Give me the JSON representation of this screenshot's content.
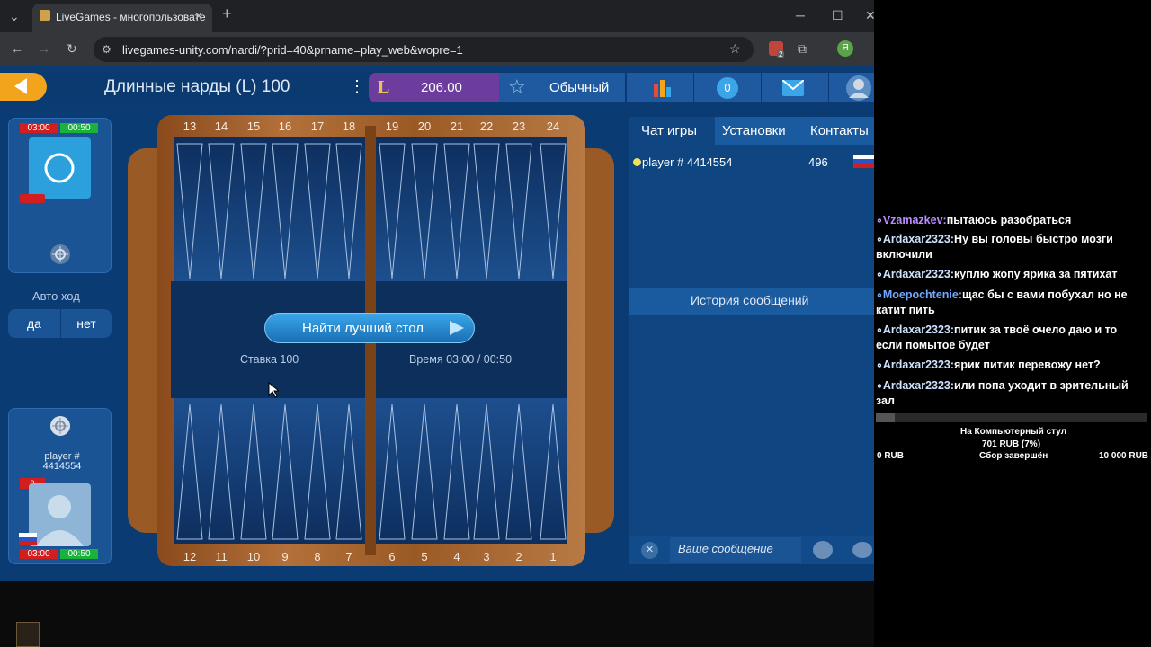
{
  "browser": {
    "tab_title": "LiveGames - многопользовате",
    "url": "livegames-unity.com/nardi/?prid=40&prname=play_web&wopre=1",
    "new_tab": "+",
    "min": "─",
    "max": "☐",
    "close": "✕",
    "profile_initial": "Я",
    "ext_badge": "2"
  },
  "game": {
    "title": "Длинные нарды (L) 100",
    "balance": "206.00",
    "mode": "Обычный",
    "badge_count": "0",
    "auto_move_label": "Авто ход",
    "auto_yes": "да",
    "auto_no": "нет",
    "find_table": "Найти лучший стол",
    "stake": "Ставка 100",
    "time": "Время 03:00 / 00:50",
    "top_numbers": [
      "13",
      "14",
      "15",
      "16",
      "17",
      "18",
      "19",
      "20",
      "21",
      "22",
      "23",
      "24"
    ],
    "bottom_numbers": [
      "12",
      "11",
      "10",
      "9",
      "8",
      "7",
      "6",
      "5",
      "4",
      "3",
      "2",
      "1"
    ]
  },
  "opponent": {
    "timer_main": "03:00",
    "timer_move": "00:50"
  },
  "player": {
    "name_line1": "player #",
    "name_line2": "4414554",
    "score": "0",
    "timer_main": "03:00",
    "timer_move": "00:50"
  },
  "chat": {
    "tabs": [
      "Чат игры",
      "Установки",
      "Контакты"
    ],
    "user_name": "player # 4414554",
    "user_rating": "496",
    "history": "История сообщений",
    "input_placeholder": "Ваше сообщение"
  },
  "stream": {
    "messages": [
      {
        "nick": "Vzamazkev:",
        "text": "пытаюсь разобраться"
      },
      {
        "nick": "Ardaxar2323:",
        "text": "Ну вы головы быстро мозги включили"
      },
      {
        "nick": "Ardaxar2323:",
        "text": "куплю жопу ярика за пятихат"
      },
      {
        "nick": "Moepochtenie:",
        "text": "щас бы с вами побухал но не катит пить"
      },
      {
        "nick": "Ardaxar2323:",
        "text": "питик за твоё очело даю и то если помытое будет"
      },
      {
        "nick": "Ardaxar2323:",
        "text": "ярик питик перевожу нет?"
      },
      {
        "nick": "Ardaxar2323:",
        "text": "или попа уходит в зрительный зал"
      }
    ],
    "goal_title": "На Компьютерный стул",
    "goal_amount": "701 RUB (7%)",
    "goal_min": "0 RUB",
    "goal_status": "Сбор завершён",
    "goal_max": "10 000 RUB",
    "goal_progress": 0.07
  },
  "colors": {
    "accent_orange": "#f2a51c",
    "page_blue": "#0a3b73",
    "timer_red": "#d21e1e",
    "timer_green": "#19b33a"
  }
}
